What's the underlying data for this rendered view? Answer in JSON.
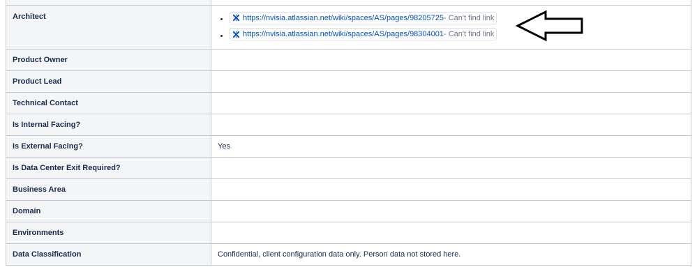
{
  "rows": {
    "architect": {
      "label": "Architect",
      "links": [
        {
          "url": "https://nvisia.atlassian.net/wiki/spaces/AS/pages/98205725",
          "status": " - Can't find link"
        },
        {
          "url": "https://nvisia.atlassian.net/wiki/spaces/AS/pages/98304001",
          "status": " - Can't find link"
        }
      ]
    },
    "product_owner": {
      "label": "Product Owner",
      "value": ""
    },
    "product_lead": {
      "label": "Product Lead",
      "value": ""
    },
    "technical_contact": {
      "label": "Technical Contact",
      "value": ""
    },
    "internal_facing": {
      "label": "Is Internal Facing?",
      "value": ""
    },
    "external_facing": {
      "label": "Is External Facing?",
      "value": "Yes"
    },
    "dc_exit": {
      "label": "Is Data Center Exit Required?",
      "value": ""
    },
    "business_area": {
      "label": "Business Area",
      "value": ""
    },
    "domain": {
      "label": "Domain",
      "value": ""
    },
    "environments": {
      "label": "Environments",
      "value": ""
    },
    "data_classification": {
      "label": "Data Classification",
      "value": "Confidential, client configuration data only. Person data not stored here."
    }
  },
  "icons": {
    "link_icon": "broken-link-icon",
    "annotation": "left-arrow-icon"
  },
  "colors": {
    "link": "#0052cc",
    "status": "#6b778c",
    "key_bg": "#f4f5f7",
    "border": "#c1c7d0"
  }
}
